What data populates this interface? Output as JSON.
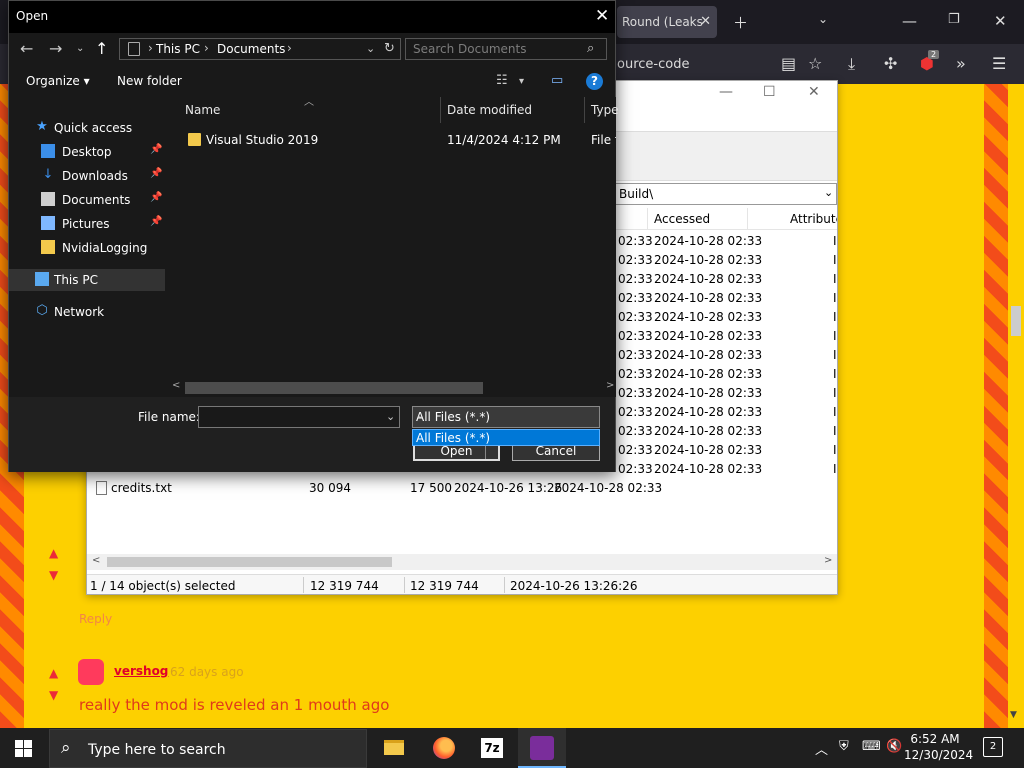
{
  "browser": {
    "tab_title": "Round (Leaks",
    "url_fragment": "ource-code",
    "ext_badge": "2"
  },
  "page": {
    "reply_label": "Reply",
    "comment": {
      "user": "vershog",
      "time": "62 days ago",
      "text": "really the mod is reveled an 1 mouth ago"
    }
  },
  "file_manager": {
    "path_fragment": "Build\\",
    "columns": [
      "Accessed",
      "Attributes"
    ],
    "rows": [
      {
        "modified_tail": "02:33",
        "accessed": "2024-10-28 02:33",
        "attr": "I"
      },
      {
        "modified_tail": "02:33",
        "accessed": "2024-10-28 02:33",
        "attr": "I"
      },
      {
        "modified_tail": "02:33",
        "accessed": "2024-10-28 02:33",
        "attr": "I"
      },
      {
        "modified_tail": "02:33",
        "accessed": "2024-10-28 02:33",
        "attr": "I"
      },
      {
        "modified_tail": "02:33",
        "accessed": "2024-10-28 02:33",
        "attr": "I"
      },
      {
        "modified_tail": "02:33",
        "accessed": "2024-10-28 02:33",
        "attr": "I"
      },
      {
        "modified_tail": "02:33",
        "accessed": "2024-10-28 02:33",
        "attr": "I"
      },
      {
        "modified_tail": "02:33",
        "accessed": "2024-10-28 02:33",
        "attr": "I"
      },
      {
        "modified_tail": "02:33",
        "accessed": "2024-10-28 02:33",
        "attr": "I"
      },
      {
        "modified_tail": "02:33",
        "accessed": "2024-10-28 02:33",
        "attr": "I"
      },
      {
        "modified_tail": "02:33",
        "accessed": "2024-10-28 02:33",
        "attr": "I"
      },
      {
        "modified_tail": "02:33",
        "accessed": "2024-10-28 02:33",
        "attr": "I"
      },
      {
        "modified_tail": "02:33",
        "accessed": "2024-10-28 02:33",
        "attr": "I"
      }
    ],
    "last_row": {
      "name": "credits.txt",
      "size": "30 094",
      "packed": "17 500",
      "modified": "2024-10-26 13:26",
      "accessed": "2024-10-28 02:33"
    },
    "status": {
      "selected": "1 / 14 object(s) selected",
      "size": "12 319 744",
      "packed": "12 319 744",
      "modified": "2024-10-26 13:26:26"
    }
  },
  "dialog": {
    "title": "Open",
    "address": [
      "This PC",
      "Documents"
    ],
    "search_placeholder": "Search Documents",
    "organize_label": "Organize ▾",
    "new_folder_label": "New folder",
    "nav": [
      {
        "label": "Quick access",
        "icon": "star-icon",
        "pinned": false
      },
      {
        "label": "Desktop",
        "icon": "desktop-icon",
        "pinned": true
      },
      {
        "label": "Downloads",
        "icon": "download-icon",
        "pinned": true
      },
      {
        "label": "Documents",
        "icon": "documents-icon",
        "pinned": true
      },
      {
        "label": "Pictures",
        "icon": "pictures-icon",
        "pinned": true
      },
      {
        "label": "NvidiaLogging",
        "icon": "folder-icon",
        "pinned": false
      },
      {
        "label": "This PC",
        "icon": "pc-icon",
        "pinned": false
      },
      {
        "label": "Network",
        "icon": "network-icon",
        "pinned": false
      }
    ],
    "columns": {
      "name": "Name",
      "modified": "Date modified",
      "type": "Type"
    },
    "files": [
      {
        "name": "Visual Studio 2019",
        "modified": "11/4/2024 4:12 PM",
        "type": "File folder"
      }
    ],
    "file_name_label": "File name:",
    "file_name_value": "",
    "file_type": "All Files (*.*)",
    "file_type_option": "All Files (*.*)",
    "open_label": "Open",
    "cancel_label": "Cancel"
  },
  "taskbar": {
    "search_text": "Type here to search",
    "time": "6:52 AM",
    "date": "12/30/2024",
    "notifications": "2"
  },
  "colors": {
    "page_yellow": "#fdd000",
    "dialog_dark": "#191919",
    "accent_blue": "#0078d7"
  }
}
